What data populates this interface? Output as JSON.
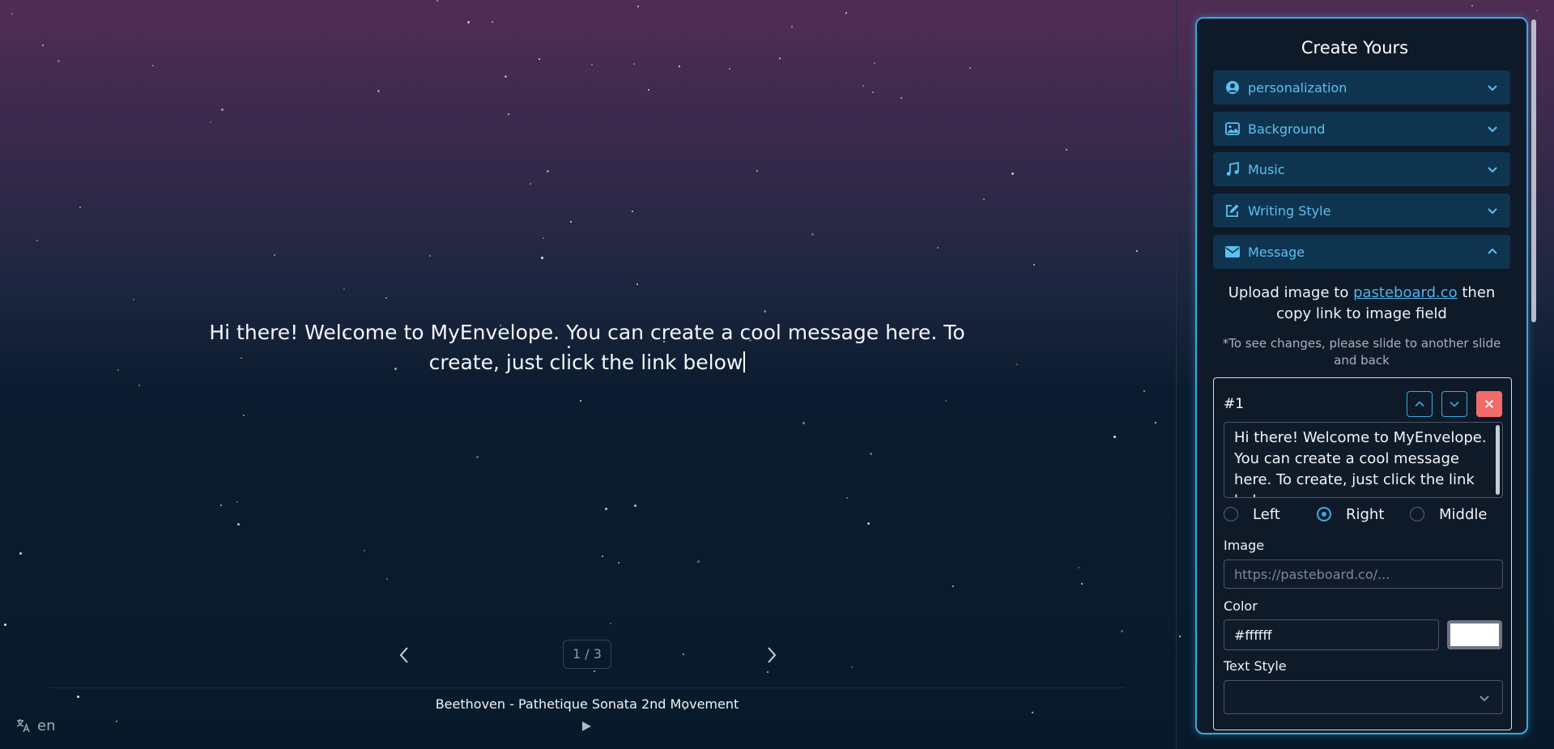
{
  "stage": {
    "message": "Hi there! Welcome to MyEnvelope. You can create a cool message here. To create, just click the link below",
    "slide_counter": "1 / 3",
    "music_title": "Beethoven - Pathetique Sonata 2nd Movement",
    "language": "en"
  },
  "panel": {
    "title": "Create Yours",
    "sections": [
      {
        "label": "personalization",
        "icon": "user-circle-icon",
        "expanded": false
      },
      {
        "label": "Background",
        "icon": "image-icon",
        "expanded": false
      },
      {
        "label": "Music",
        "icon": "music-icon",
        "expanded": false
      },
      {
        "label": "Writing Style",
        "icon": "edit-icon",
        "expanded": false
      },
      {
        "label": "Message",
        "icon": "envelope-icon",
        "expanded": true
      }
    ],
    "upload": {
      "prefix": "Upload image to ",
      "link": "pasteboard.co",
      "suffix": " then copy link to image field"
    },
    "note": "*To see changes, please slide to another slide and back",
    "slide": {
      "number": "#1",
      "text": "Hi there! Welcome to MyEnvelope. You can create a cool message here. To create, just click the link below",
      "alignment_options": [
        "Left",
        "Right",
        "Middle"
      ],
      "alignment_selected": "Right",
      "image_label": "Image",
      "image_placeholder": "https://pasteboard.co/...",
      "color_label": "Color",
      "color_value": "#ffffff",
      "text_style_label": "Text Style",
      "text_style_value": ""
    }
  },
  "colors": {
    "accent": "#3aa8e0",
    "section_bg": "#0f3450",
    "delete": "#f26b6b"
  }
}
